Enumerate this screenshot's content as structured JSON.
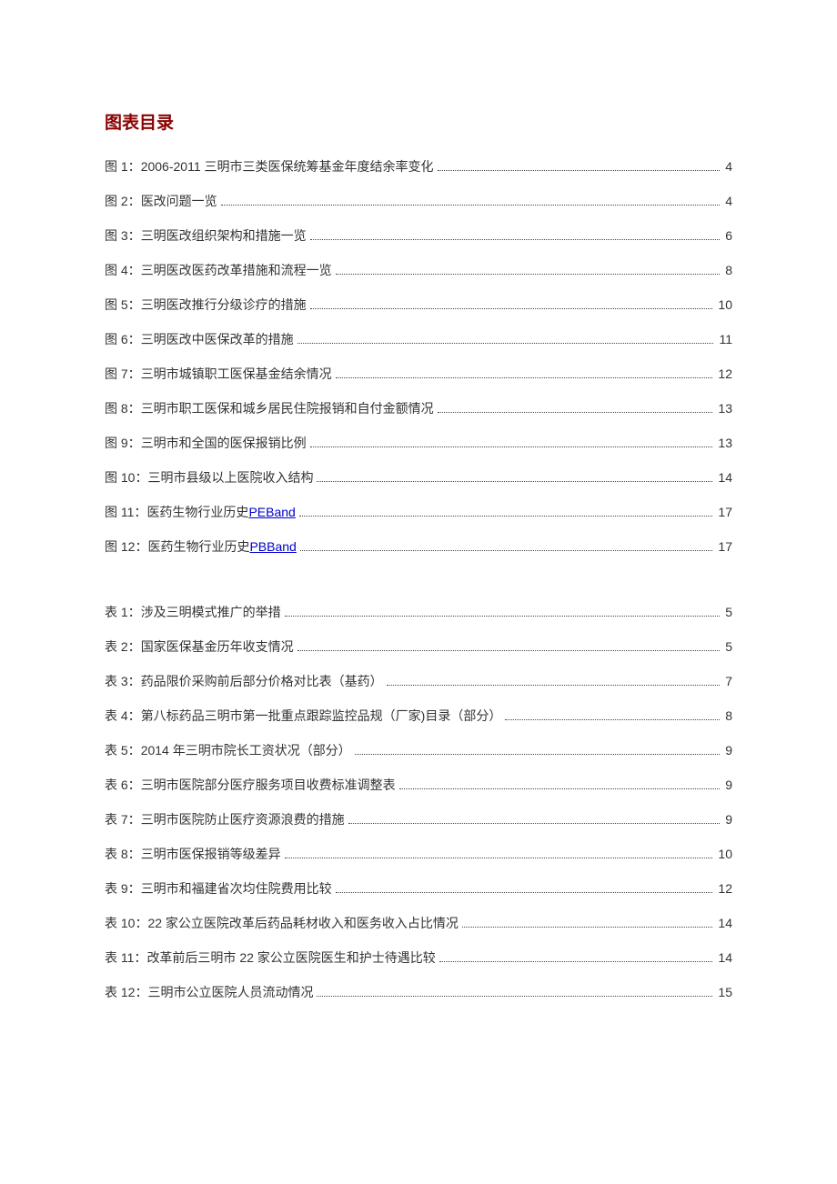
{
  "heading": "图表目录",
  "figures": [
    {
      "label": "图 1：",
      "title_plain": "2006-2011 三明市三类医保统筹基金年度结余率变化",
      "page": "4"
    },
    {
      "label": "图 2：",
      "title_plain": "医改问题一览",
      "page": "4"
    },
    {
      "label": "图 3：",
      "title_plain": "三明医改组织架构和措施一览",
      "page": "6"
    },
    {
      "label": "图 4：",
      "title_plain": "三明医改医药改革措施和流程一览",
      "page": "8"
    },
    {
      "label": "图 5：",
      "title_plain": "三明医改推行分级诊疗的措施",
      "page": "10"
    },
    {
      "label": "图 6：",
      "title_plain": "三明医改中医保改革的措施",
      "page": "11"
    },
    {
      "label": "图 7：",
      "title_plain": "三明市城镇职工医保基金结余情况",
      "page": "12"
    },
    {
      "label": "图 8：",
      "title_plain": "三明市职工医保和城乡居民住院报销和自付金额情况",
      "page": "13"
    },
    {
      "label": "图 9：",
      "title_plain": "三明市和全国的医保报销比例",
      "page": "13"
    },
    {
      "label": "图 10：",
      "title_plain": "三明市县级以上医院收入结构",
      "page": "14"
    },
    {
      "label": "图 11：",
      "title_prefix": "医药生物行业历史",
      "title_link": "PEBand",
      "page": "17"
    },
    {
      "label": "图 12：",
      "title_prefix": "医药生物行业历史",
      "title_link": "PBBand",
      "page": "17"
    }
  ],
  "tables": [
    {
      "label": "表 1：",
      "title_plain": "涉及三明模式推广的举措",
      "page": "5"
    },
    {
      "label": "表 2：",
      "title_plain": "国家医保基金历年收支情况",
      "page": "5"
    },
    {
      "label": "表 3：",
      "title_plain": "药品限价采购前后部分价格对比表（基药）",
      "page": "7"
    },
    {
      "label": "表 4：",
      "title_plain": "第八标药品三明市第一批重点跟踪监控品规（厂家)目录（部分）",
      "page": "8"
    },
    {
      "label": "表 5：",
      "title_plain": "2014 年三明市院长工资状况（部分）",
      "page": "9"
    },
    {
      "label": "表 6：",
      "title_plain": "三明市医院部分医疗服务项目收费标准调整表",
      "page": "9"
    },
    {
      "label": "表 7：",
      "title_plain": "三明市医院防止医疗资源浪费的措施",
      "page": "9"
    },
    {
      "label": "表 8：",
      "title_plain": "三明市医保报销等级差异",
      "page": "10"
    },
    {
      "label": "表 9：",
      "title_plain": "三明市和福建省次均住院费用比较",
      "page": "12"
    },
    {
      "label": "表 10：",
      "title_plain": "22 家公立医院改革后药品耗材收入和医务收入占比情况",
      "page": "14"
    },
    {
      "label": "表 11：",
      "title_plain": "改革前后三明市 22 家公立医院医生和护士待遇比较",
      "page": "14"
    },
    {
      "label": "表 12：",
      "title_plain": "三明市公立医院人员流动情况",
      "page": "15"
    }
  ]
}
